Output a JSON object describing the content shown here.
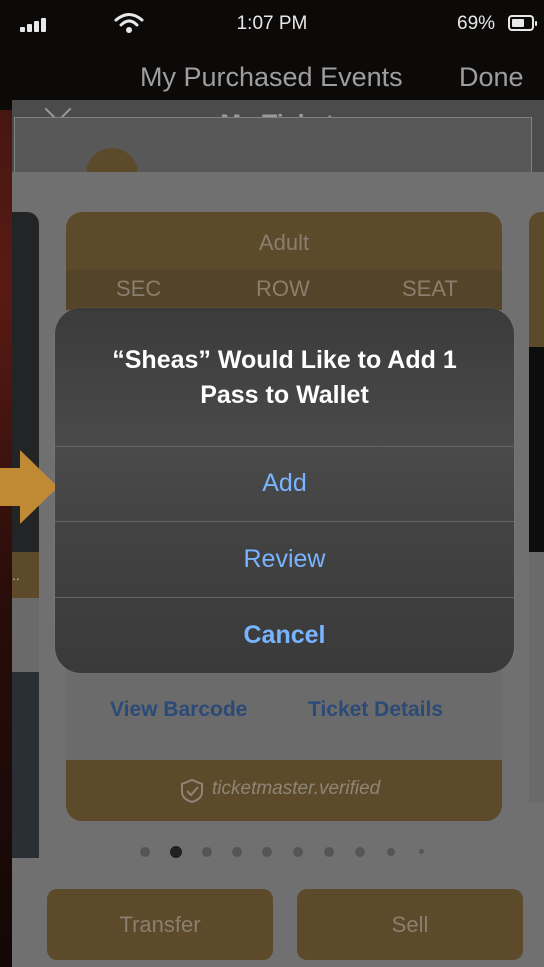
{
  "status_bar": {
    "time": "1:07 PM",
    "battery_percent": "69%",
    "icons": [
      "signal-icon",
      "wifi-icon",
      "battery-icon"
    ]
  },
  "nav": {
    "title": "My Purchased Events",
    "done_label": "Done"
  },
  "modal": {
    "title": "My Tickets",
    "close_icon": "close-icon"
  },
  "ticket": {
    "type": "Adult",
    "headers": [
      "SEC",
      "ROW",
      "SEAT"
    ],
    "view_barcode_label": "View Barcode",
    "ticket_details_label": "Ticket Details",
    "verified_label": "ticketmaster.verified"
  },
  "pager": {
    "count": 10,
    "active_index": 1
  },
  "actions": {
    "transfer_label": "Transfer",
    "sell_label": "Sell"
  },
  "alert": {
    "title": "“Sheas” Would Like to Add 1 Pass to Wallet",
    "add_label": "Add",
    "review_label": "Review",
    "cancel_label": "Cancel"
  },
  "colors": {
    "gold": "#5d4a2b",
    "alert_button": "#78b4ff",
    "link_blue": "#2b4a78",
    "arrow_orange": "#c08a35"
  }
}
